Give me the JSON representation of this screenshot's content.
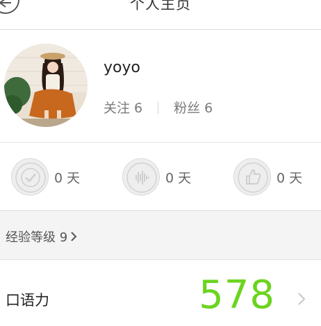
{
  "header": {
    "title": "个人主页"
  },
  "profile": {
    "username": "yoyo",
    "following": "关注 6",
    "followers": "粉丝 6"
  },
  "badges": [
    {
      "icon": "check-badge-icon",
      "days": "0 天"
    },
    {
      "icon": "soundwave-badge-icon",
      "days": "0 天"
    },
    {
      "icon": "thumbs-up-badge-icon",
      "days": "0 天"
    }
  ],
  "experience": {
    "label": "经验等级 9"
  },
  "oral": {
    "label": "口语力",
    "score": "578"
  },
  "colors": {
    "score": "#6bd41f",
    "divider": "#d9d9d9"
  }
}
